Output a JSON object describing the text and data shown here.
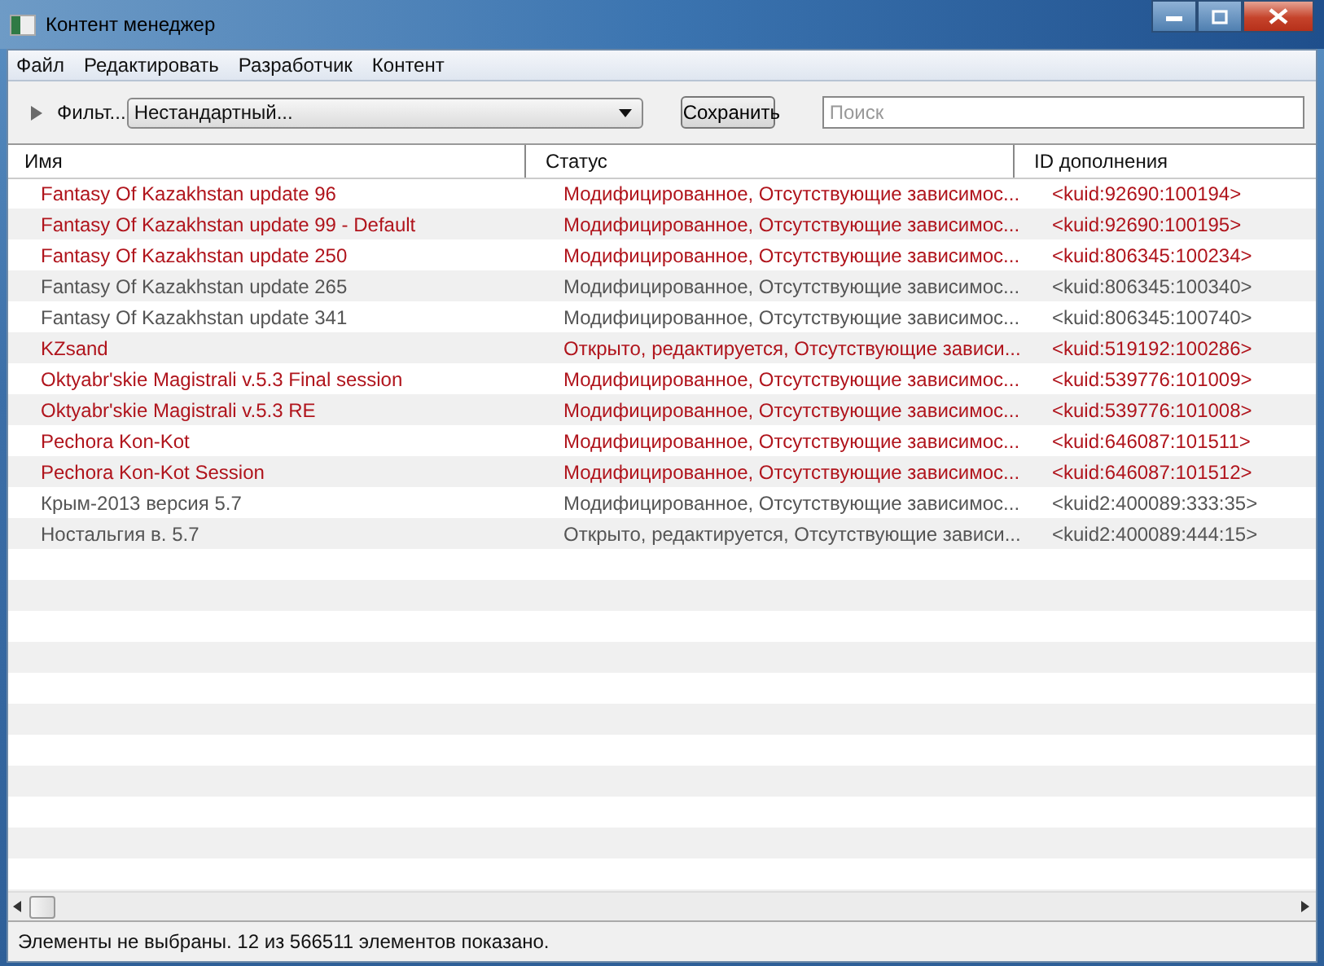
{
  "window": {
    "title": "Контент менеджер"
  },
  "menu": [
    "Файл",
    "Редактировать",
    "Разработчик",
    "Контент"
  ],
  "toolbar": {
    "filter_label": "Фильт...",
    "filter_expanded": false,
    "filter_value": "Нестандартный...",
    "save_button": "Сохранить",
    "search": {
      "placeholder": "Поиск"
    }
  },
  "table": {
    "columns": [
      "Имя",
      "Статус",
      "ID дополнения"
    ],
    "rows": [
      {
        "name": "Fantasy Of Kazakhstan update 96",
        "status": "Модифицированное, Отсутствующие зависимос...",
        "id": "<kuid:92690:100194>",
        "error": true
      },
      {
        "name": "Fantasy Of Kazakhstan update 99 - Default",
        "status": "Модифицированное, Отсутствующие зависимос...",
        "id": "<kuid:92690:100195>",
        "error": true
      },
      {
        "name": "Fantasy Of Kazakhstan update 250",
        "status": "Модифицированное, Отсутствующие зависимос...",
        "id": "<kuid:806345:100234>",
        "error": true
      },
      {
        "name": "Fantasy Of Kazakhstan update 265",
        "status": "Модифицированное, Отсутствующие зависимос...",
        "id": "<kuid:806345:100340>",
        "error": false
      },
      {
        "name": "Fantasy Of Kazakhstan update 341",
        "status": "Модифицированное, Отсутствующие зависимос...",
        "id": "<kuid:806345:100740>",
        "error": false
      },
      {
        "name": "KZsand",
        "status": "Открыто, редактируется, Отсутствующие зависи...",
        "id": "<kuid:519192:100286>",
        "error": true
      },
      {
        "name": "Oktyabr'skie Magistrali v.5.3 Final session",
        "status": "Модифицированное, Отсутствующие зависимос...",
        "id": "<kuid:539776:101009>",
        "error": true
      },
      {
        "name": "Oktyabr'skie Magistrali v.5.3 RE",
        "status": "Модифицированное, Отсутствующие зависимос...",
        "id": "<kuid:539776:101008>",
        "error": true
      },
      {
        "name": "Pechora Kon-Kot",
        "status": "Модифицированное, Отсутствующие зависимос...",
        "id": "<kuid:646087:101511>",
        "error": true
      },
      {
        "name": "Pechora Kon-Kot Session",
        "status": "Модифицированное, Отсутствующие зависимос...",
        "id": "<kuid:646087:101512>",
        "error": true
      },
      {
        "name": "Крым-2013 версия 5.7",
        "status": "Модифицированное, Отсутствующие зависимос...",
        "id": "<kuid2:400089:333:35>",
        "error": false
      },
      {
        "name": "Ностальгия в. 5.7",
        "status": "Открыто, редактируется, Отсутствующие зависи...",
        "id": "<kuid2:400089:444:15>",
        "error": false
      }
    ]
  },
  "status_bar": "Элементы не выбраны. 12 из 566511 элементов показано."
}
